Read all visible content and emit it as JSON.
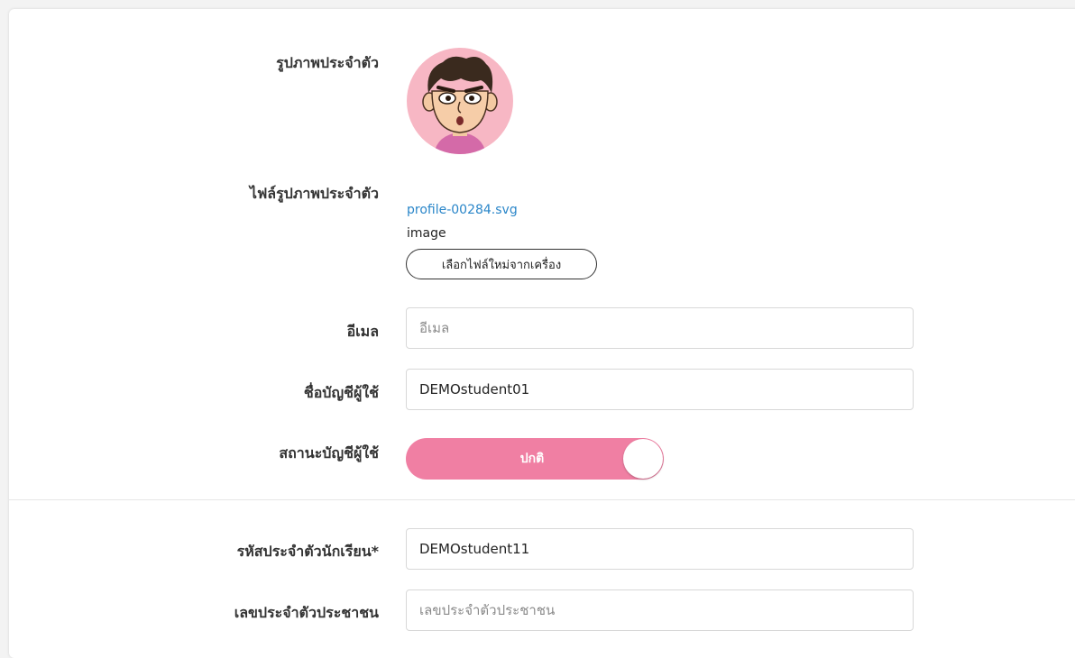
{
  "profile_picture": {
    "label": "รูปภาพประจำตัว",
    "icon": "cartoon-boy-avatar"
  },
  "profile_file": {
    "label": "ไฟล์รูปภาพประจำตัว",
    "filename": "profile-00284.svg",
    "type": "image",
    "choose_button": "เลือกไฟล์ใหม่จากเครื่อง"
  },
  "email": {
    "label": "อีเมล",
    "value": "",
    "placeholder": "อีเมล"
  },
  "username": {
    "label": "ชื่อบัญชีผู้ใช้",
    "value": "DEMOstudent01",
    "placeholder": ""
  },
  "account_status": {
    "label": "สถานะบัญชีผู้ใช้",
    "value": "ปกติ",
    "enabled": true,
    "color": "#f07fa3"
  },
  "student_id": {
    "label": "รหัสประจำตัวนักเรียน*",
    "value": "DEMOstudent11",
    "placeholder": ""
  },
  "national_id": {
    "label": "เลขประจำตัวประชาชน",
    "value": "",
    "placeholder": "เลขประจำตัวประชาชน"
  },
  "colors": {
    "link": "#2a86c9",
    "avatar_bg": "#f7b7c4",
    "toggle_on": "#f07fa3"
  }
}
